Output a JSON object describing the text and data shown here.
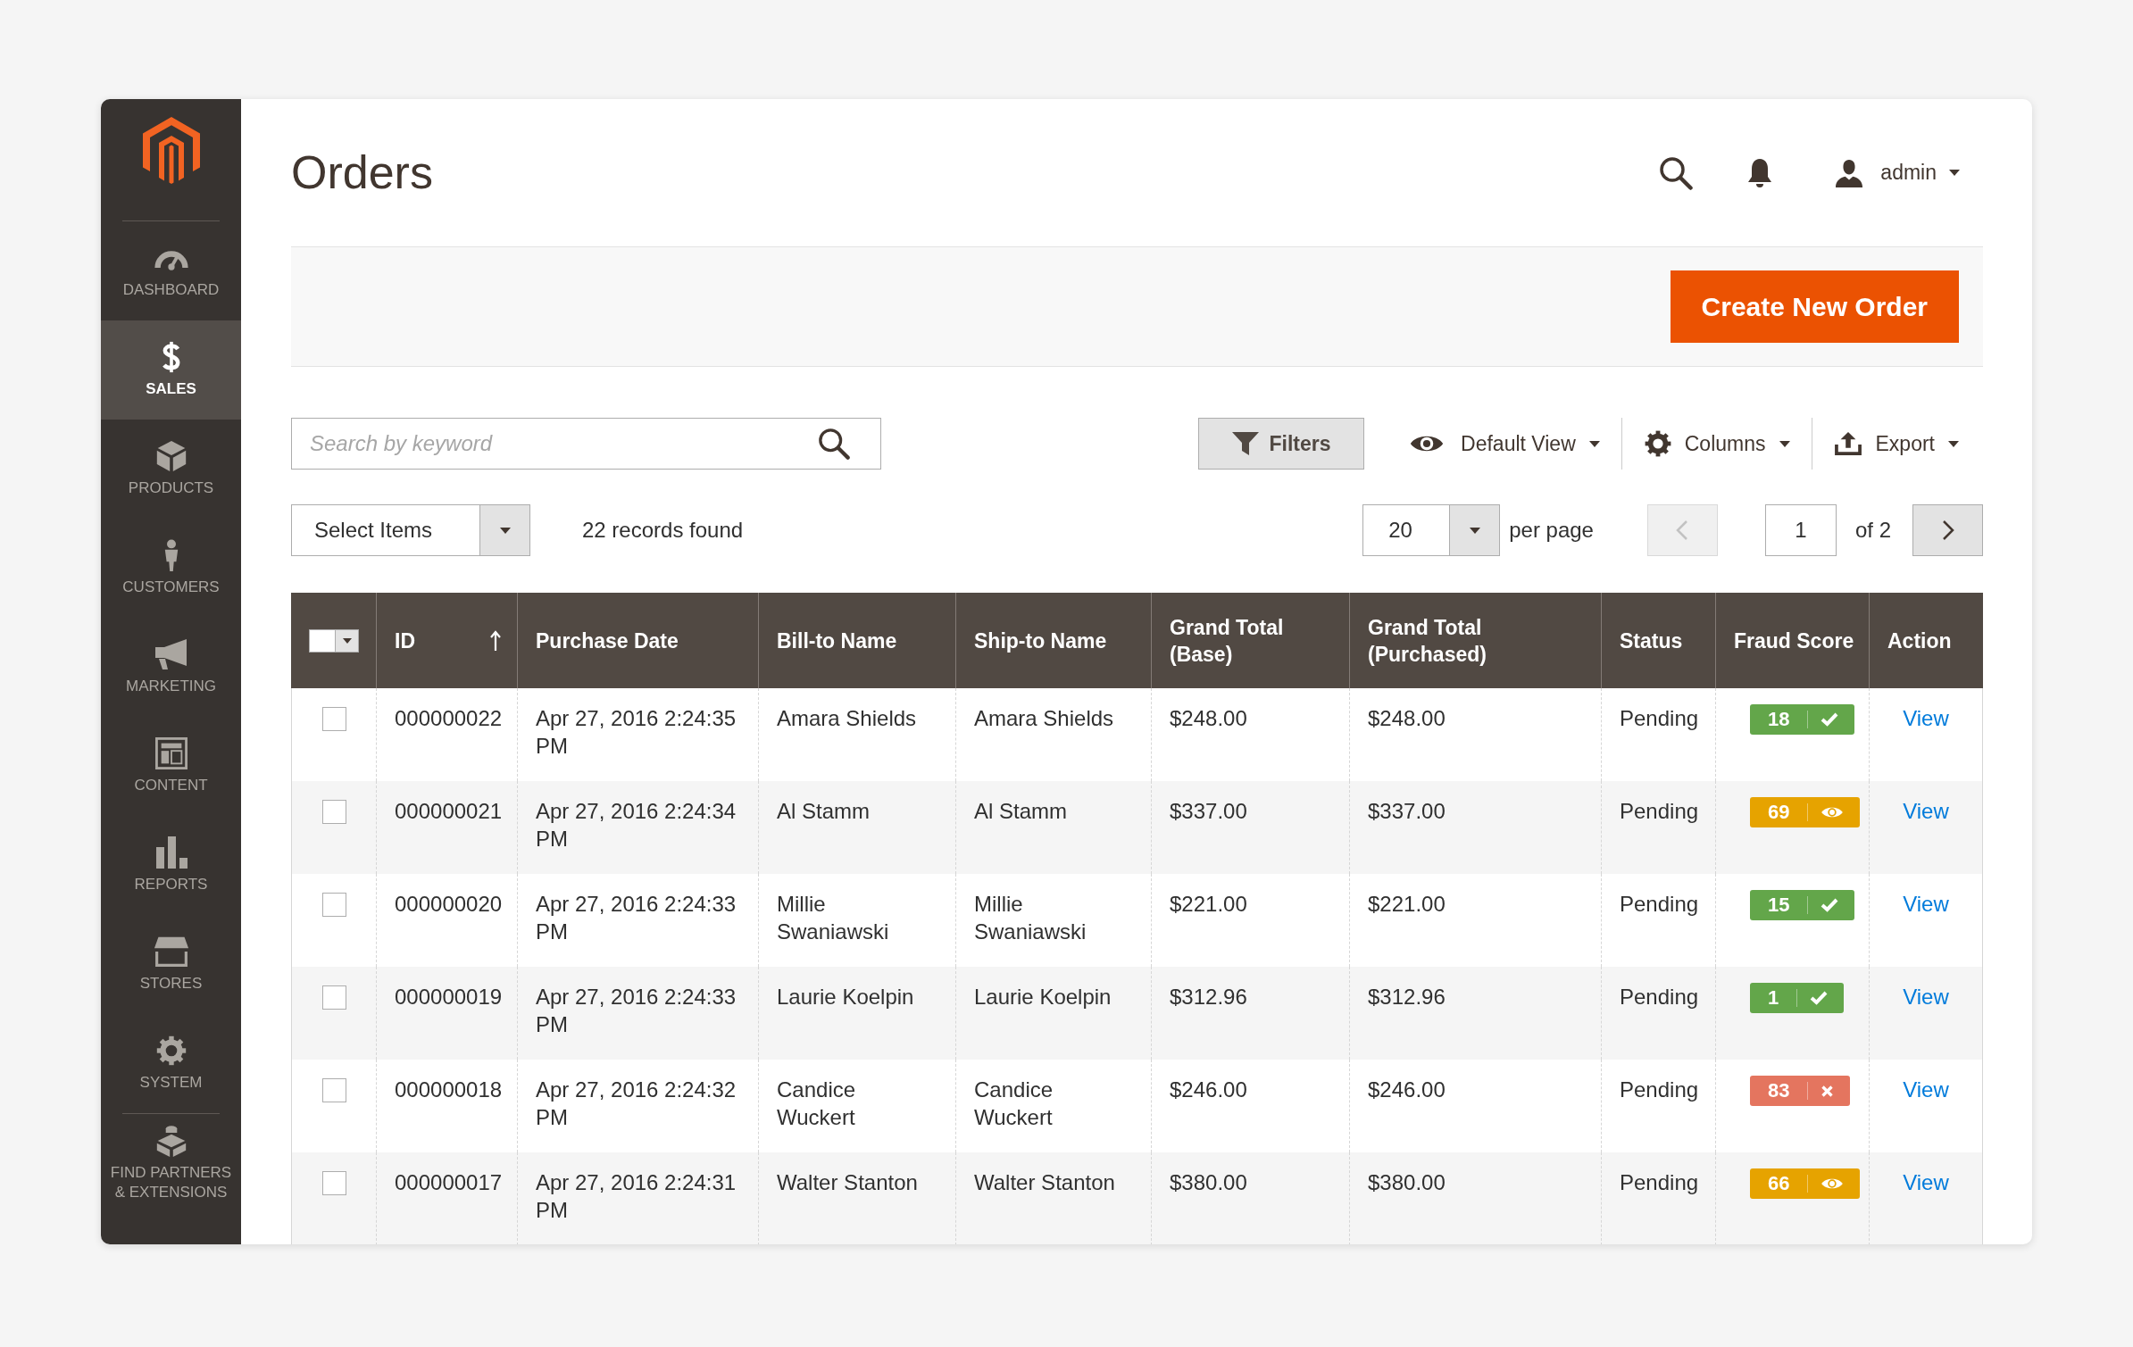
{
  "sidebar": {
    "items": [
      {
        "label": "DASHBOARD",
        "kind": "dashboard",
        "selected": false
      },
      {
        "label": "SALES",
        "kind": "sales",
        "selected": true
      },
      {
        "label": "PRODUCTS",
        "kind": "products",
        "selected": false
      },
      {
        "label": "CUSTOMERS",
        "kind": "customers",
        "selected": false
      },
      {
        "label": "MARKETING",
        "kind": "marketing",
        "selected": false
      },
      {
        "label": "CONTENT",
        "kind": "content",
        "selected": false
      },
      {
        "label": "REPORTS",
        "kind": "reports",
        "selected": false
      },
      {
        "label": "STORES",
        "kind": "stores",
        "selected": false
      },
      {
        "label": "SYSTEM",
        "kind": "system",
        "selected": false
      },
      {
        "label": "FIND PARTNERS & EXTENSIONS",
        "kind": "partners",
        "selected": false
      }
    ]
  },
  "header": {
    "title": "Orders",
    "user": "admin"
  },
  "action_bar": {
    "button": "Create New Order"
  },
  "toolbar": {
    "search": {
      "placeholder": "Search by keyword"
    },
    "controls": [
      {
        "label": "Filters",
        "kind": "filters"
      },
      {
        "label": "Default View",
        "kind": "view"
      },
      {
        "label": "Columns",
        "kind": "columns"
      },
      {
        "label": "Export",
        "kind": "export"
      }
    ]
  },
  "mass_action": {
    "value": "Select Items"
  },
  "records_found": "22 records found",
  "pagination": {
    "page_size": "20",
    "page_size_label": "per page",
    "previous": {
      "disabled": true
    },
    "page": "1",
    "total": "of 2",
    "next": {
      "disabled": false
    }
  },
  "table": {
    "select_all": {
      "checked": false
    },
    "columns": [
      {
        "label": "ID",
        "sorted": true
      },
      {
        "label": "Purchase Date",
        "sorted": false
      },
      {
        "label": "Bill-to Name",
        "sorted": false
      },
      {
        "label": "Ship-to Name",
        "sorted": false
      },
      {
        "label": "Grand Total (Base)",
        "sorted": false
      },
      {
        "label": "Grand Total (Purchased)",
        "sorted": false
      },
      {
        "label": "Status",
        "sorted": false
      },
      {
        "label": "Fraud Score",
        "sorted": false
      },
      {
        "label": "Action",
        "sorted": false
      }
    ],
    "rows": [
      {
        "selected": false,
        "id": "000000022",
        "purchase_date": "Apr 27, 2016 2:24:35 PM",
        "bill_to_name": "Amara Shields",
        "ship_to_name": "Amara Shields",
        "grand_total_base": "$248.00",
        "grand_total_purchased": "$248.00",
        "status": "Pending",
        "fraud_score": {
          "score": "18",
          "kind": "approve",
          "color": "#63a64a"
        },
        "action": "View"
      },
      {
        "selected": false,
        "id": "000000021",
        "purchase_date": "Apr 27, 2016 2:24:34 PM",
        "bill_to_name": "Al Stamm",
        "ship_to_name": "Al Stamm",
        "grand_total_base": "$337.00",
        "grand_total_purchased": "$337.00",
        "status": "Pending",
        "fraud_score": {
          "score": "69",
          "kind": "review",
          "color": "#e6a300"
        },
        "action": "View"
      },
      {
        "selected": false,
        "id": "000000020",
        "purchase_date": "Apr 27, 2016 2:24:33 PM",
        "bill_to_name": "Millie Swaniawski",
        "ship_to_name": "Millie Swaniawski",
        "grand_total_base": "$221.00",
        "grand_total_purchased": "$221.00",
        "status": "Pending",
        "fraud_score": {
          "score": "15",
          "kind": "approve",
          "color": "#63a64a"
        },
        "action": "View"
      },
      {
        "selected": false,
        "id": "000000019",
        "purchase_date": "Apr 27, 2016 2:24:33 PM",
        "bill_to_name": "Laurie Koelpin",
        "ship_to_name": "Laurie Koelpin",
        "grand_total_base": "$312.96",
        "grand_total_purchased": "$312.96",
        "status": "Pending",
        "fraud_score": {
          "score": "1",
          "kind": "approve",
          "color": "#63a64a"
        },
        "action": "View"
      },
      {
        "selected": false,
        "id": "000000018",
        "purchase_date": "Apr 27, 2016 2:24:32 PM",
        "bill_to_name": "Candice Wuckert",
        "ship_to_name": "Candice Wuckert",
        "grand_total_base": "$246.00",
        "grand_total_purchased": "$246.00",
        "status": "Pending",
        "fraud_score": {
          "score": "83",
          "kind": "decline",
          "color": "#e4755f"
        },
        "action": "View"
      },
      {
        "selected": false,
        "id": "000000017",
        "purchase_date": "Apr 27, 2016 2:24:31 PM",
        "bill_to_name": "Walter Stanton",
        "ship_to_name": "Walter Stanton",
        "grand_total_base": "$380.00",
        "grand_total_purchased": "$380.00",
        "status": "Pending",
        "fraud_score": {
          "score": "66",
          "kind": "review",
          "color": "#e6a300"
        },
        "action": "View"
      }
    ]
  }
}
